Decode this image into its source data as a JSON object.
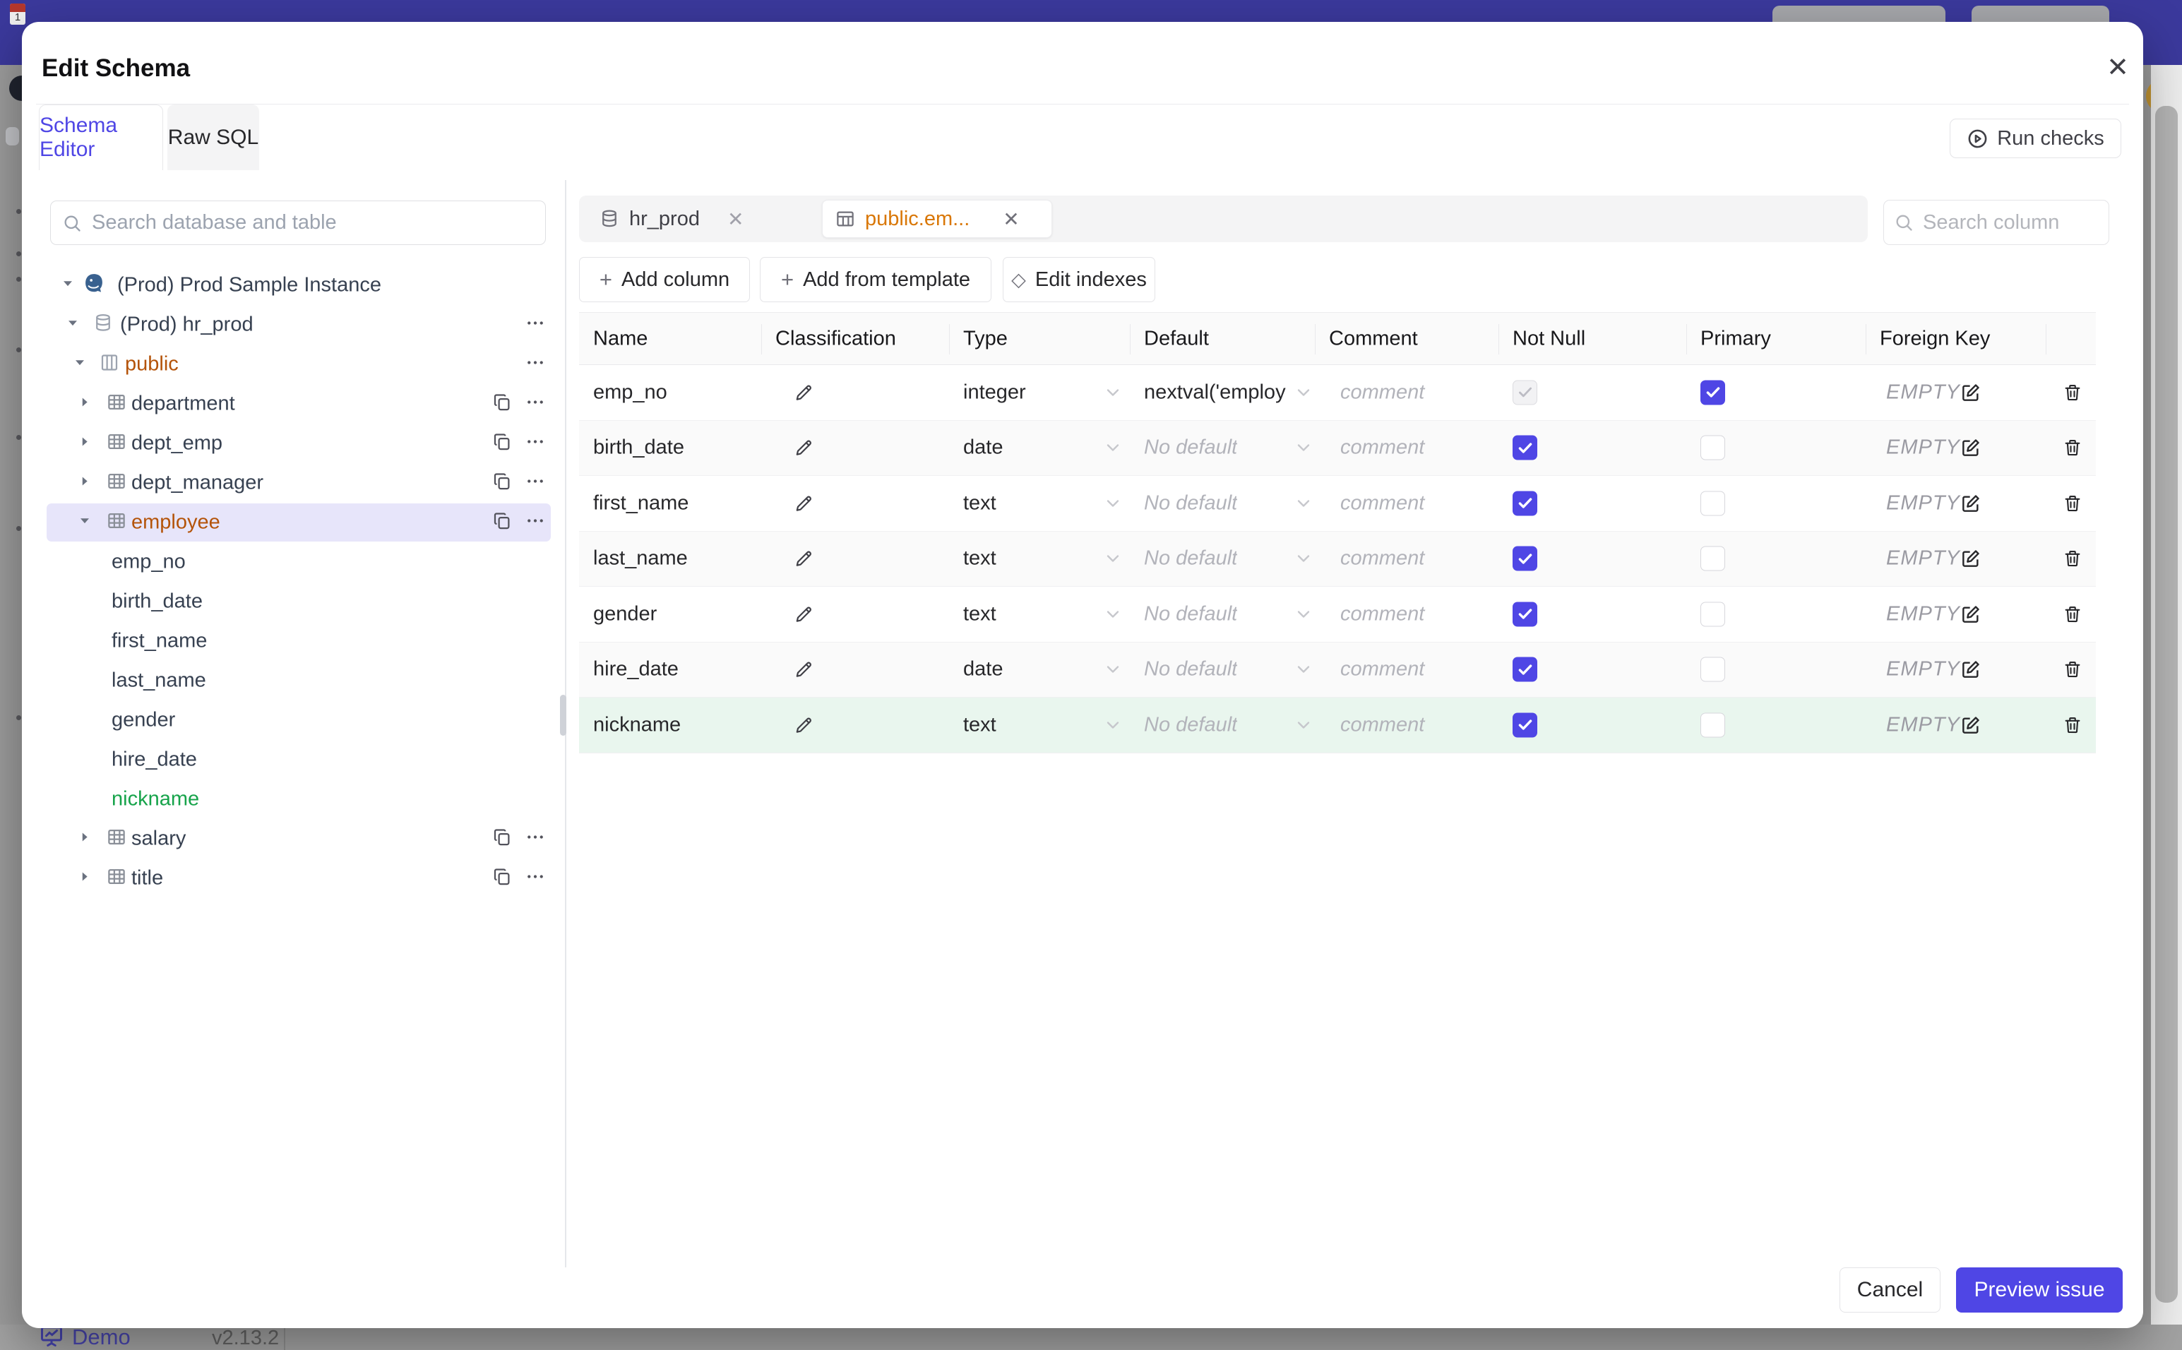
{
  "backdrop": {
    "calendar_day": "1",
    "demo_label": "Demo",
    "version": "v2.13.2"
  },
  "modal": {
    "title": "Edit Schema",
    "close_icon": "✕",
    "editor_tabs": [
      {
        "label": "Schema Editor",
        "active": true
      },
      {
        "label": "Raw SQL",
        "active": false
      }
    ],
    "run_checks_label": "Run checks",
    "sidebar": {
      "search_placeholder": "Search database and table",
      "tree": [
        {
          "label": "(Prod) Prod Sample Instance",
          "level": 0,
          "caret": "down",
          "icon": "postgres-icon",
          "actions": []
        },
        {
          "label": "(Prod) hr_prod",
          "level": 1,
          "caret": "down",
          "icon": "database-icon",
          "actions": [
            "dots"
          ]
        },
        {
          "label": "public",
          "level": 2,
          "caret": "down",
          "icon": "schema-icon",
          "color": "amber",
          "actions": [
            "dots"
          ]
        },
        {
          "label": "department",
          "level": 3,
          "caret": "right",
          "icon": "table-icon",
          "actions": [
            "copy",
            "dots"
          ]
        },
        {
          "label": "dept_emp",
          "level": 3,
          "caret": "right",
          "icon": "table-icon",
          "actions": [
            "copy",
            "dots"
          ]
        },
        {
          "label": "dept_manager",
          "level": 3,
          "caret": "right",
          "icon": "table-icon",
          "actions": [
            "copy",
            "dots"
          ]
        },
        {
          "label": "employee",
          "level": 3,
          "caret": "down",
          "icon": "table-icon",
          "color": "amber",
          "highlighted": true,
          "actions": [
            "copy",
            "dots"
          ]
        },
        {
          "label": "emp_no",
          "level": "column"
        },
        {
          "label": "birth_date",
          "level": "column"
        },
        {
          "label": "first_name",
          "level": "column"
        },
        {
          "label": "last_name",
          "level": "column"
        },
        {
          "label": "gender",
          "level": "column"
        },
        {
          "label": "hire_date",
          "level": "column"
        },
        {
          "label": "nickname",
          "level": "column",
          "color": "green"
        },
        {
          "label": "salary",
          "level": 3,
          "caret": "right",
          "icon": "table-icon",
          "actions": [
            "copy",
            "dots"
          ]
        },
        {
          "label": "title",
          "level": 3,
          "caret": "right",
          "icon": "table-icon",
          "actions": [
            "copy",
            "dots"
          ]
        }
      ]
    },
    "main": {
      "tabs": [
        {
          "label": "hr_prod",
          "icon": "database-icon",
          "active": false
        },
        {
          "label": "public.em...",
          "icon": "table-icon",
          "active": true
        }
      ],
      "toolbar": [
        {
          "label": "Add column",
          "icon": "plus-icon"
        },
        {
          "label": "Add from template",
          "icon": "plus-icon"
        },
        {
          "label": "Edit indexes",
          "icon": "lozenge-icon"
        }
      ],
      "search_placeholder": "Search column",
      "table": {
        "columns": [
          "Name",
          "Classification",
          "Type",
          "Default",
          "Comment",
          "Not Null",
          "Primary",
          "Foreign Key"
        ],
        "rows": [
          {
            "name": "emp_no",
            "type": "integer",
            "default": "nextval('employ",
            "default_placeholder": false,
            "comment": "comment",
            "not_null": true,
            "not_null_disabled": true,
            "primary": true,
            "foreign_key": "EMPTY"
          },
          {
            "name": "birth_date",
            "type": "date",
            "default": "No default",
            "default_placeholder": true,
            "comment": "comment",
            "not_null": true,
            "not_null_disabled": false,
            "primary": false,
            "foreign_key": "EMPTY"
          },
          {
            "name": "first_name",
            "type": "text",
            "default": "No default",
            "default_placeholder": true,
            "comment": "comment",
            "not_null": true,
            "not_null_disabled": false,
            "primary": false,
            "foreign_key": "EMPTY"
          },
          {
            "name": "last_name",
            "type": "text",
            "default": "No default",
            "default_placeholder": true,
            "comment": "comment",
            "not_null": true,
            "not_null_disabled": false,
            "primary": false,
            "foreign_key": "EMPTY"
          },
          {
            "name": "gender",
            "type": "text",
            "default": "No default",
            "default_placeholder": true,
            "comment": "comment",
            "not_null": true,
            "not_null_disabled": false,
            "primary": false,
            "foreign_key": "EMPTY"
          },
          {
            "name": "hire_date",
            "type": "date",
            "default": "No default",
            "default_placeholder": true,
            "comment": "comment",
            "not_null": true,
            "not_null_disabled": false,
            "primary": false,
            "foreign_key": "EMPTY"
          },
          {
            "name": "nickname",
            "type": "text",
            "default": "No default",
            "default_placeholder": true,
            "comment": "comment",
            "not_null": true,
            "not_null_disabled": false,
            "primary": false,
            "foreign_key": "EMPTY",
            "highlight": "green"
          }
        ]
      }
    },
    "footer": {
      "cancel_label": "Cancel",
      "primary_label": "Preview issue"
    }
  },
  "colors": {
    "accent": "#4f46e5",
    "tree_amber": "#b45309",
    "tab_amber": "#d97706",
    "green": "#16a34a",
    "tree_highlight": "#e7e5fa",
    "row_highlight": "#e9f6ee",
    "topbar": "#3b399c"
  }
}
